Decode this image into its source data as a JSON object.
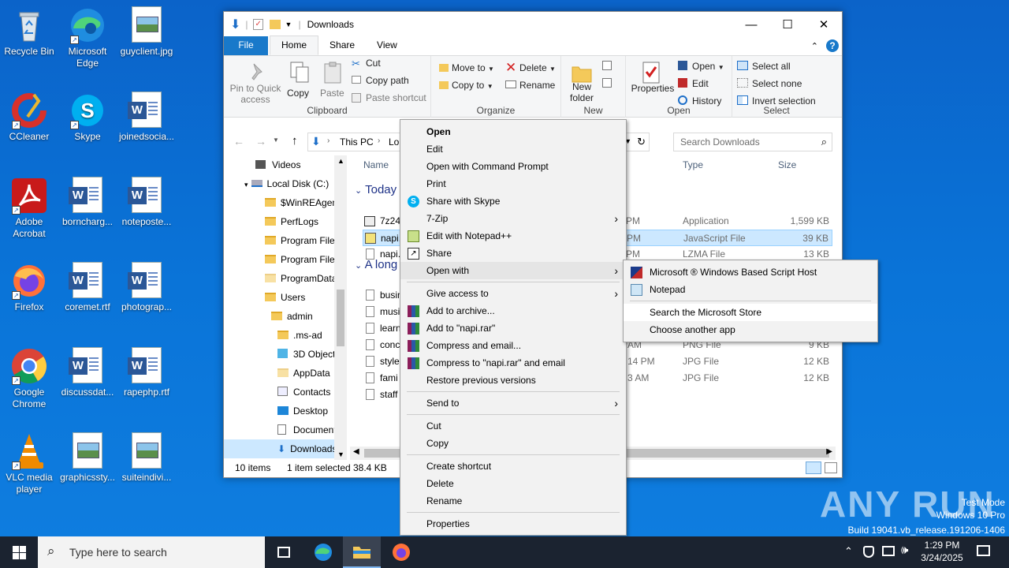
{
  "desktop": {
    "icons": [
      {
        "label": "Recycle Bin"
      },
      {
        "label": "Microsoft Edge"
      },
      {
        "label": "guyclient.jpg"
      },
      {
        "label": "CCleaner"
      },
      {
        "label": "Skype"
      },
      {
        "label": "joinedsocia..."
      },
      {
        "label": "Adobe Acrobat"
      },
      {
        "label": "borncharg..."
      },
      {
        "label": "noteposte..."
      },
      {
        "label": "Firefox"
      },
      {
        "label": "coremet.rtf"
      },
      {
        "label": "photograp..."
      },
      {
        "label": "Google Chrome"
      },
      {
        "label": "discussdat..."
      },
      {
        "label": "rapephp.rtf"
      },
      {
        "label": "VLC media player"
      },
      {
        "label": "graphicssty..."
      },
      {
        "label": "suiteindivi..."
      }
    ]
  },
  "explorer": {
    "title": "Downloads",
    "tabs": {
      "file": "File",
      "home": "Home",
      "share": "Share",
      "view": "View"
    },
    "ribbon": {
      "pin": "Pin to Quick access",
      "copy": "Copy",
      "paste": "Paste",
      "cut": "Cut",
      "copy_path": "Copy path",
      "paste_shortcut": "Paste shortcut",
      "clipboard": "Clipboard",
      "move_to": "Move to",
      "copy_to": "Copy to",
      "delete": "Delete",
      "rename": "Rename",
      "organize": "Organize",
      "new_folder": "New folder",
      "new": "New",
      "properties": "Properties",
      "open": "Open",
      "edit": "Edit",
      "history": "History",
      "open_group": "Open",
      "select_all": "Select all",
      "select_none": "Select none",
      "invert_selection": "Invert selection",
      "select_group": "Select"
    },
    "address": {
      "this_pc": "This PC",
      "local": "Lo",
      "search_placeholder": "Search Downloads"
    },
    "nav": [
      {
        "label": "Videos"
      },
      {
        "label": "Local Disk (C:)"
      },
      {
        "label": "$WinREAgent"
      },
      {
        "label": "PerfLogs"
      },
      {
        "label": "Program Files"
      },
      {
        "label": "Program Files"
      },
      {
        "label": "ProgramData"
      },
      {
        "label": "Users"
      },
      {
        "label": "admin"
      },
      {
        "label": ".ms-ad"
      },
      {
        "label": "3D Objects"
      },
      {
        "label": "AppData"
      },
      {
        "label": "Contacts"
      },
      {
        "label": "Desktop"
      },
      {
        "label": "Documents"
      },
      {
        "label": "Downloads"
      }
    ],
    "columns": {
      "name": "Name",
      "type": "Type",
      "size": "Size"
    },
    "groups": {
      "today": "Today",
      "along": "A long"
    },
    "files": [
      {
        "name": "7z24",
        "date": "7 PM",
        "type": "Application",
        "size": "1,599 KB"
      },
      {
        "name": "napi.",
        "date": "7 PM",
        "type": "JavaScript File",
        "size": "39 KB"
      },
      {
        "name": "napi.",
        "date": "7 PM",
        "type": "LZMA File",
        "size": "13 KB"
      },
      {
        "name": "busin",
        "date": "",
        "type": "",
        "size": ""
      },
      {
        "name": "musi",
        "date": "",
        "type": "",
        "size": ""
      },
      {
        "name": "learn",
        "date": "",
        "type": "",
        "size": ""
      },
      {
        "name": "conc",
        "date": "AM",
        "type": "PNG File",
        "size": "9 KB"
      },
      {
        "name": "style",
        "date": "14 PM",
        "type": "JPG File",
        "size": "12 KB"
      },
      {
        "name": "fami",
        "date": "3 AM",
        "type": "JPG File",
        "size": "12 KB"
      },
      {
        "name": "staff",
        "date": "",
        "type": "",
        "size": ""
      }
    ],
    "status": {
      "items": "10 items",
      "selected": "1 item selected",
      "size": "38.4 KB"
    }
  },
  "context_menu": {
    "items": [
      "Open",
      "Edit",
      "Open with Command Prompt",
      "Print",
      "Share with Skype",
      "7-Zip",
      "Edit with Notepad++",
      "Share",
      "Open with",
      "Give access to",
      "Add to archive...",
      "Add to \"napi.rar\"",
      "Compress and email...",
      "Compress to \"napi.rar\" and email",
      "Restore previous versions",
      "Send to",
      "Cut",
      "Copy",
      "Create shortcut",
      "Delete",
      "Rename",
      "Properties"
    ]
  },
  "submenu": {
    "items": [
      "Microsoft ® Windows Based Script Host",
      "Notepad",
      "Search the Microsoft Store",
      "Choose another app"
    ]
  },
  "watermark": {
    "brand": "ANY RUN",
    "mode": "Test Mode",
    "os": "Windows 10 Pro",
    "build": "Build 19041.vb_release.191206-1406"
  },
  "taskbar": {
    "search_placeholder": "Type here to search",
    "time": "1:29 PM",
    "date": "3/24/2025"
  }
}
